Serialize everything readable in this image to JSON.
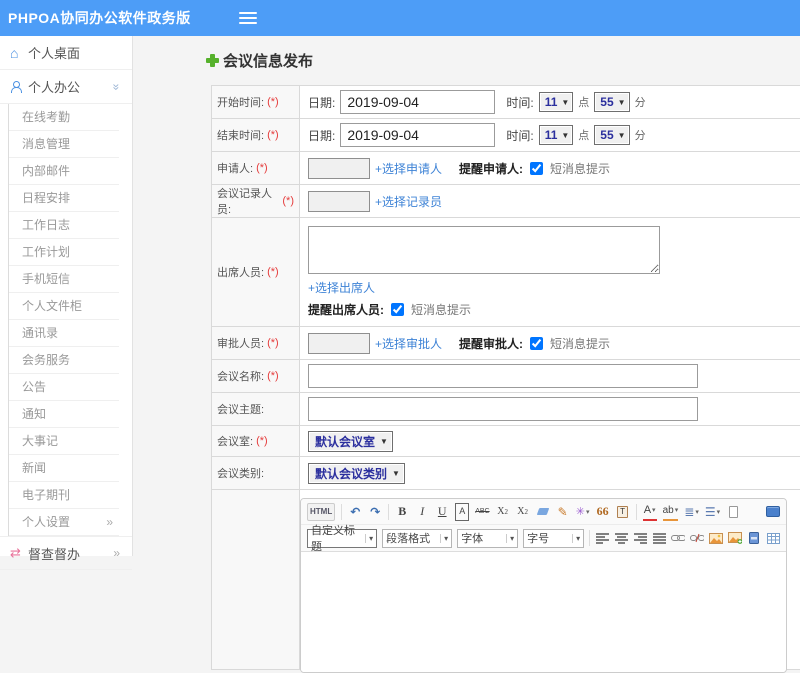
{
  "topbar": {
    "brand": "PHPOA协同办公软件政务版"
  },
  "sidebar": {
    "desktop": "个人桌面",
    "office": "个人办公",
    "sub_items": [
      "在线考勤",
      "消息管理",
      "内部邮件",
      "日程安排",
      "工作日志",
      "工作计划",
      "手机短信",
      "个人文件柜",
      "通讯录",
      "会务服务",
      "公告",
      "通知",
      "大事记",
      "新闻",
      "电子期刊"
    ],
    "settings": "个人设置",
    "supervision": "督查督办"
  },
  "main": {
    "title": "会议信息发布",
    "form": {
      "required": "(*)",
      "date_label": "日期:",
      "time_label": "时间:",
      "hour_suffix": "点",
      "minute_suffix": "分",
      "start": {
        "label": "开始时间:",
        "date": "2019-09-04",
        "hour": "11",
        "minute": "55"
      },
      "end": {
        "label": "结束时间:",
        "date": "2019-09-04",
        "hour": "11",
        "minute": "55"
      },
      "applicant": {
        "label": "申请人:",
        "link": "+选择申请人",
        "remind": "提醒申请人:",
        "sms": "短消息提示",
        "checked": "checked"
      },
      "recorder": {
        "label": "会议记录人员:",
        "link": "+选择记录员"
      },
      "attendees": {
        "label": "出席人员:",
        "link": "+选择出席人",
        "remind": "提醒出席人员:",
        "sms": "短消息提示",
        "checked": "checked"
      },
      "approver": {
        "label": "审批人员:",
        "link": "+选择审批人",
        "remind": "提醒审批人:",
        "sms": "短消息提示",
        "checked": "checked"
      },
      "name": {
        "label": "会议名称:"
      },
      "subject": {
        "label": "会议主题:"
      },
      "room": {
        "label": "会议室:",
        "value": "默认会议室"
      },
      "category": {
        "label": "会议类别:",
        "value": "默认会议类别"
      }
    }
  },
  "editor": {
    "html_btn": "HTML",
    "quote": "66",
    "selects": {
      "heading": "自定义标题",
      "paragraph": "段落格式",
      "font": "字体",
      "size": "字号"
    }
  },
  "colors": {
    "topbar_bg": "#4d9df7",
    "icon_blue": "#4a90e2",
    "link_blue": "#3e83d6",
    "select_text": "#2b2f9e",
    "required_red": "#e53c3c",
    "plus_green": "#56b12c"
  }
}
